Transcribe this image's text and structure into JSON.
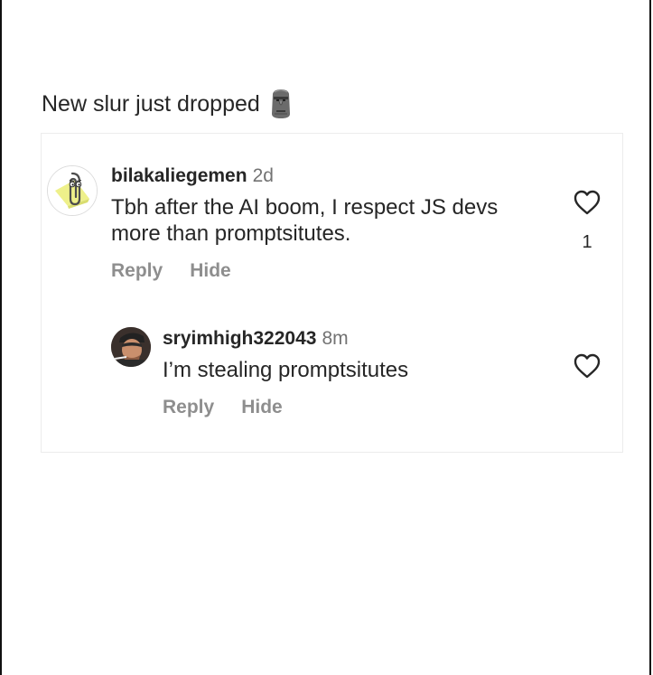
{
  "post": {
    "caption": "New slur just dropped",
    "caption_emoji": "moai-icon"
  },
  "comments": [
    {
      "username": "bilakaliegemen",
      "time": "2d",
      "text": "Tbh after the AI boom, I respect JS devs more than promptsitutes.",
      "like_count": "1",
      "reply_label": "Reply",
      "hide_label": "Hide",
      "avatar": "paperclip-assistant-avatar"
    }
  ],
  "replies": [
    {
      "username": "sryimhigh322043",
      "time": "8m",
      "text": "I’m stealing promptsitutes",
      "reply_label": "Reply",
      "hide_label": "Hide",
      "avatar": "man-with-cigarette-avatar"
    }
  ],
  "colors": {
    "primary_text": "#262626",
    "secondary_text": "#737373",
    "action_text": "#8e8e8e",
    "card_border": "#ececec"
  }
}
